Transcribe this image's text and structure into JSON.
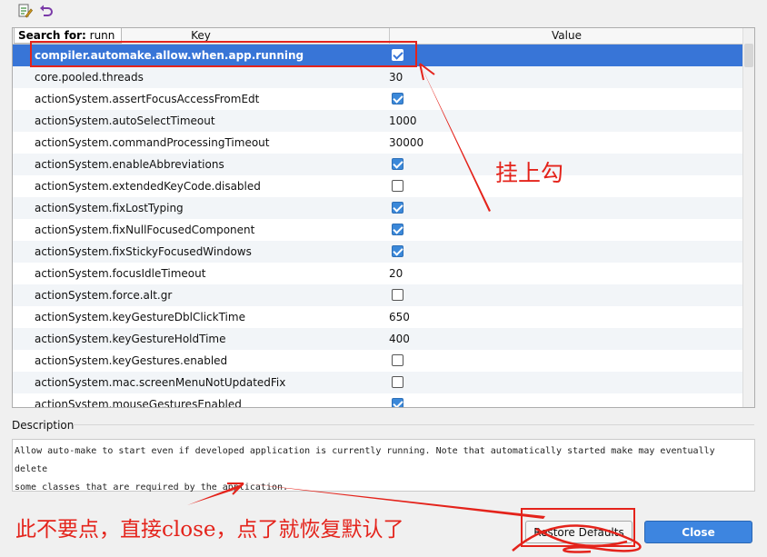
{
  "toolbar": {
    "edit_icon": "edit-properties-icon",
    "undo_icon": "undo-arrow-icon"
  },
  "table": {
    "search_label": "Search for:",
    "search_value": "runn",
    "columns": {
      "key": "Key",
      "value": "Value"
    },
    "rows": [
      {
        "key": "compiler.automake.allow.when.app.running",
        "type": "bool",
        "checked": true,
        "selected": true
      },
      {
        "key": "core.pooled.threads",
        "type": "text",
        "value": "30"
      },
      {
        "key": "actionSystem.assertFocusAccessFromEdt",
        "type": "bool",
        "checked": true
      },
      {
        "key": "actionSystem.autoSelectTimeout",
        "type": "text",
        "value": "1000"
      },
      {
        "key": "actionSystem.commandProcessingTimeout",
        "type": "text",
        "value": "30000"
      },
      {
        "key": "actionSystem.enableAbbreviations",
        "type": "bool",
        "checked": true
      },
      {
        "key": "actionSystem.extendedKeyCode.disabled",
        "type": "bool",
        "checked": false
      },
      {
        "key": "actionSystem.fixLostTyping",
        "type": "bool",
        "checked": true
      },
      {
        "key": "actionSystem.fixNullFocusedComponent",
        "type": "bool",
        "checked": true
      },
      {
        "key": "actionSystem.fixStickyFocusedWindows",
        "type": "bool",
        "checked": true
      },
      {
        "key": "actionSystem.focusIdleTimeout",
        "type": "text",
        "value": "20"
      },
      {
        "key": "actionSystem.force.alt.gr",
        "type": "bool",
        "checked": false
      },
      {
        "key": "actionSystem.keyGestureDblClickTime",
        "type": "text",
        "value": "650"
      },
      {
        "key": "actionSystem.keyGestureHoldTime",
        "type": "text",
        "value": "400"
      },
      {
        "key": "actionSystem.keyGestures.enabled",
        "type": "bool",
        "checked": false
      },
      {
        "key": "actionSystem.mac.screenMenuNotUpdatedFix",
        "type": "bool",
        "checked": false
      },
      {
        "key": "actionSystem.mouseGesturesEnabled",
        "type": "bool",
        "checked": true
      }
    ]
  },
  "description": {
    "label": "Description",
    "text_line1": "Allow auto-make to start even if developed application is currently running. Note that automatically started make may eventually delete",
    "text_line2": "some classes that are required by the application."
  },
  "buttons": {
    "restore_label": "Restore Defaults",
    "close_label": "Close"
  },
  "annotations": {
    "right_note": "挂上勾",
    "bottom_note": "此不要点，直接close，点了就恢复默认了",
    "color": "#e4231b"
  },
  "colors": {
    "selection": "#3875d7",
    "close_button": "#3d85e0",
    "checkbox_on": "#3b88d9"
  }
}
